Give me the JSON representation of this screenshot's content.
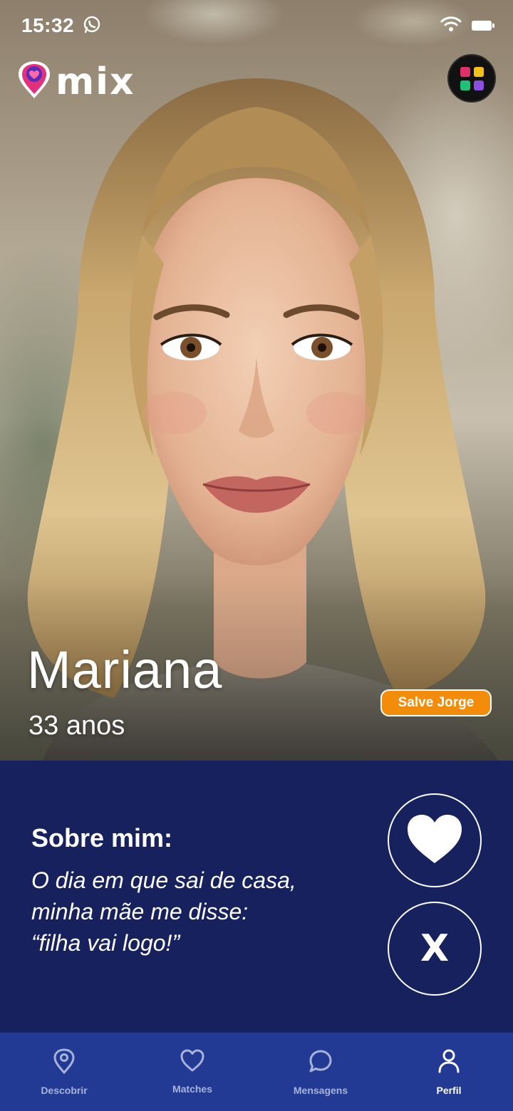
{
  "status_bar": {
    "time": "15:32",
    "notification_icon": "whatsapp-icon",
    "wifi_icon": "wifi-icon",
    "battery_icon": "battery-icon"
  },
  "header": {
    "logo_text": "mix",
    "logo_icon": "heart-pin-icon",
    "menu_icon": "app-grid-icon",
    "grid_colors": [
      "#e0306a",
      "#f2c21a",
      "#1fc07a",
      "#8a4fe0"
    ]
  },
  "profile": {
    "name": "Mariana",
    "age": "33 anos",
    "tag": "Salve Jorge"
  },
  "bio": {
    "title": "Sobre mim:",
    "lines": [
      "O dia em que sai de casa,",
      "minha mãe me disse:",
      "“filha vai logo!”"
    ]
  },
  "actions": {
    "like_icon": "heart-icon",
    "dislike_label": "X"
  },
  "nav": {
    "items": [
      {
        "label": "Descobrir",
        "icon": "location-pin-icon",
        "active": false
      },
      {
        "label": "Matches",
        "icon": "heart-outline-icon",
        "active": false
      },
      {
        "label": "Mensagens",
        "icon": "chat-bubble-icon",
        "active": false
      },
      {
        "label": "Perfil",
        "icon": "user-icon",
        "active": true
      }
    ]
  },
  "colors": {
    "panel_bg": "#17215e",
    "nav_bg": "#223a93",
    "tag_bg": "#f28c0a",
    "nav_inactive": "#a8b3d8",
    "nav_active": "#ffffff"
  }
}
